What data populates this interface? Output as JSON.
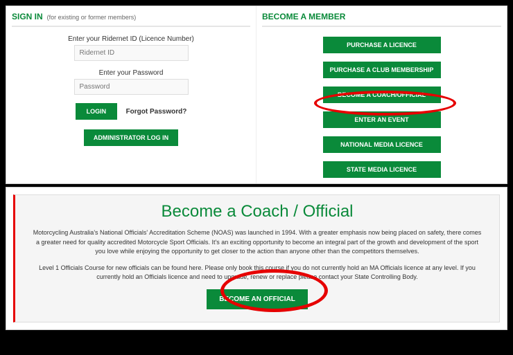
{
  "signin": {
    "title": "SIGN IN",
    "subtitle": "(for existing or former members)",
    "ridernetLabel": "Enter your Ridernet ID (Licence Number)",
    "ridernetPlaceholder": "Ridernet ID",
    "passwordLabel": "Enter your Password",
    "passwordPlaceholder": "Password",
    "loginBtn": "LOGIN",
    "forgot": "Forgot Password?",
    "adminBtn": "ADMINISTRATOR LOG IN"
  },
  "member": {
    "title": "BECOME A MEMBER",
    "buttons": {
      "licence": "PURCHASE A LICENCE",
      "club": "PURCHASE A CLUB MEMBERSHIP",
      "coach": "BECOME A COACH/OFFICIAL",
      "event": "ENTER AN EVENT",
      "nationalMedia": "NATIONAL MEDIA LICENCE",
      "stateMedia": "STATE MEDIA LICENCE"
    }
  },
  "coach": {
    "title": "Become a Coach / Official",
    "para1": "Motorcycling Australia's National Officials' Accreditation Scheme (NOAS) was launched in 1994. With a greater emphasis now being placed on safety, there comes a greater need for quality accredited Motorcycle Sport Officials. It's an exciting opportunity to become an integral part of the growth and development of the sport you love while enjoying the opportunity to get closer to the action than anyone other than the competitors themselves.",
    "para2": "Level 1 Officials Course for new officials can be found here. Please only book this course if you do not currently hold an MA Officials licence at any level. If you currently hold an Officials licence and need to upgrade, renew or replace please contact your State Controlling Body.",
    "btn": "BECOME AN OFFICIAL"
  }
}
